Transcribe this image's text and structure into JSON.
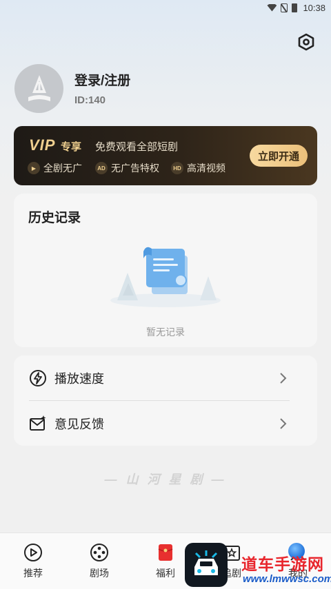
{
  "status_bar": {
    "time": "10:38",
    "icons": [
      "wifi-icon",
      "no-sim-icon",
      "battery-icon"
    ]
  },
  "header": {
    "settings_icon": "settings-hexagon-icon"
  },
  "profile": {
    "login_label": "登录/注册",
    "user_id": "ID:140",
    "avatar_icon": "default-avatar-icon"
  },
  "vip": {
    "logo": "VIP",
    "tag": "专享",
    "description": "免费观看全部短剧",
    "features": [
      {
        "label": "全剧无广",
        "icon": "video-icon"
      },
      {
        "label": "无广告特权",
        "icon": "ad-badge-icon",
        "badge": "AD"
      },
      {
        "label": "高清视频",
        "icon": "hd-badge-icon",
        "badge": "HD"
      }
    ],
    "button_label": "立即开通",
    "colors": {
      "gold": "#efcf8f",
      "dark": "#1e1a16"
    }
  },
  "history": {
    "title": "历史记录",
    "empty_text": "暂无记录"
  },
  "menu": {
    "items": [
      {
        "label": "播放速度",
        "icon": "speed-bolt-icon"
      },
      {
        "label": "意见反馈",
        "icon": "feedback-mail-icon"
      }
    ]
  },
  "brand": {
    "text": "— 山 河 星 剧 —"
  },
  "bottom_nav": {
    "items": [
      {
        "label": "推荐",
        "icon": "play-circle-icon"
      },
      {
        "label": "剧场",
        "icon": "film-reel-icon"
      },
      {
        "label": "福利",
        "icon": "red-envelope-icon"
      },
      {
        "label": "追剧",
        "icon": "star-folder-icon"
      },
      {
        "label": "我的",
        "icon": "profile-icon"
      }
    ]
  },
  "watermark": {
    "title": "道车手游网",
    "url": "www.lmwwsc.com"
  }
}
